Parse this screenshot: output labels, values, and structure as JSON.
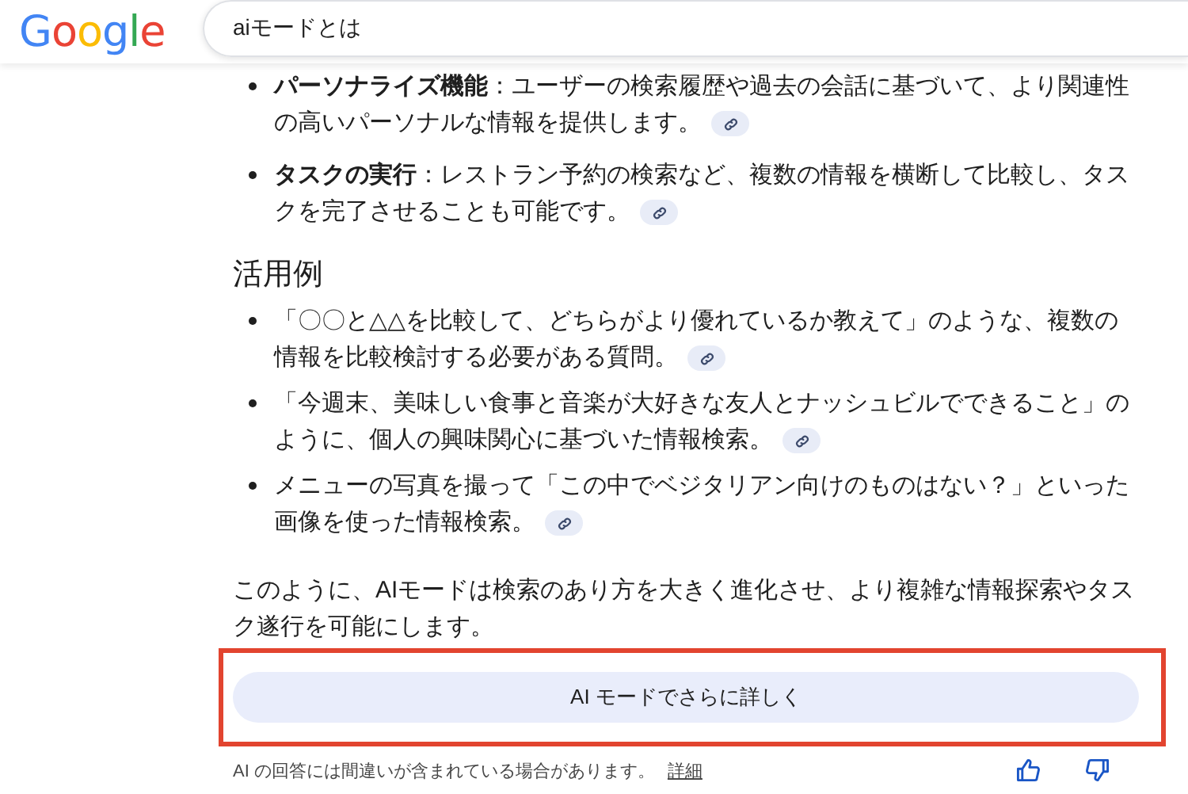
{
  "logo": "Google",
  "search": {
    "value": "aiモードとは"
  },
  "features": [
    {
      "text": "**パーソナライズ機能**：ユーザーの検索履歴や過去の会話に基づいて、より関連性の高いパーソナルな情報を提供します。"
    },
    {
      "text": "**タスクの実行**：レストラン予約の検索など、複数の情報を横断して比較し、タスクを完了させることも可能です。"
    }
  ],
  "section_heading": "活用例",
  "examples": [
    {
      "text": "「〇〇と△△を比較して、どちらがより優れているか教えて」のような、複数の情報を比較検討する必要がある質問。"
    },
    {
      "text": "「今週末、美味しい食事と音楽が大好きな友人とナッシュビルでできること」のように、個人の興味関心に基づいた情報検索。"
    },
    {
      "text": "メニューの写真を撮って「この中でベジタリアン向けのものはない？」といった画像を使った情報検索。"
    }
  ],
  "summary": "このように、AIモードは検索のあり方を大きく進化させ、より複雑な情報探索やタスク遂行を可能にします。",
  "more_button": "AI モードでさらに詳しく",
  "disclaimer": "AI の回答には間違いが含まれている場合があります。",
  "details_link": "詳細"
}
